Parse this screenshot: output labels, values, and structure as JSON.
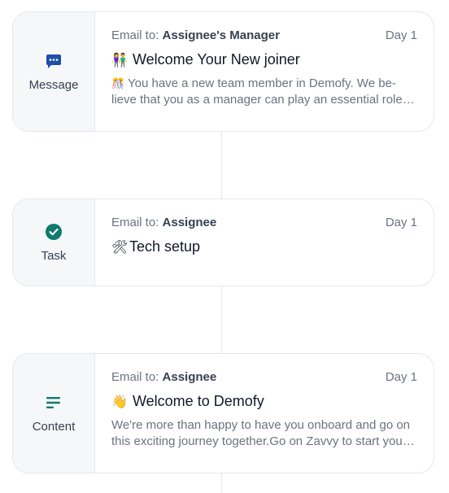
{
  "colors": {
    "accent": "#1e4fa8",
    "task": "#0f7a6d",
    "content": "#0f7a6d"
  },
  "cards": [
    {
      "type": "Message",
      "icon": "chat-bubble-icon",
      "email_prefix": "Email to:",
      "recipient": "Assignee's Manager",
      "day": "Day 1",
      "title_emoji": "👫",
      "title": "Welcome Your New joiner",
      "preview_emoji": "🎊",
      "preview": "You have a new team member in Demofy. We be-lieve that you as a manager can play an essential role in making their first days great."
    },
    {
      "type": "Task",
      "icon": "check-circle-icon",
      "email_prefix": "Email to:",
      "recipient": "Assignee",
      "day": "Day 1",
      "title_emoji": "🛠",
      "title": "Tech setup"
    },
    {
      "type": "Content",
      "icon": "text-lines-icon",
      "email_prefix": "Email to:",
      "recipient": "Assignee",
      "day": "Day 1",
      "title_emoji": "👋",
      "title": "Welcome to Demofy",
      "preview": "We're more than happy to have you onboard and go on this exciting journey together.Go on Zavvy to start your onboarding."
    }
  ]
}
